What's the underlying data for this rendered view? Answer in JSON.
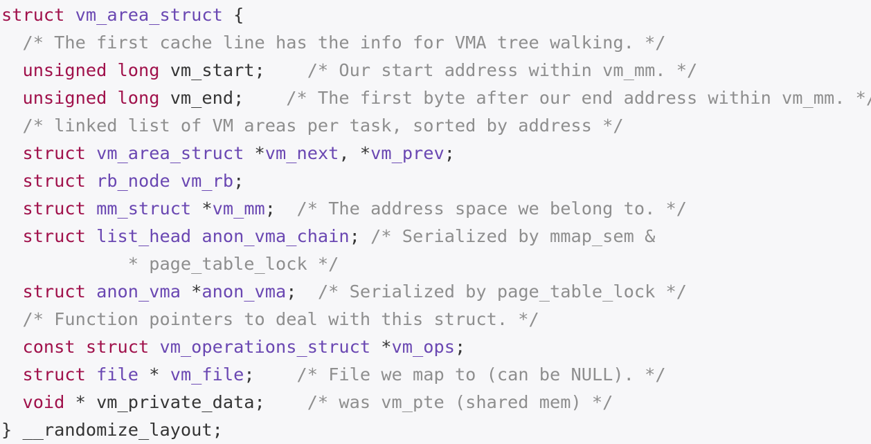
{
  "colors": {
    "background": "#f7f7f9",
    "keyword": "#a0114b",
    "type": "#6a47b2",
    "comment": "#8e8e8e",
    "plain": "#353535"
  },
  "code": {
    "lines": [
      [
        {
          "t": "keyword",
          "v": "struct"
        },
        {
          "t": "plain",
          "v": " "
        },
        {
          "t": "type",
          "v": "vm_area_struct"
        },
        {
          "t": "plain",
          "v": " {"
        }
      ],
      [
        {
          "t": "plain",
          "v": "  "
        },
        {
          "t": "comment",
          "v": "/* The first cache line has the info for VMA tree walking. */"
        }
      ],
      [
        {
          "t": "plain",
          "v": "  "
        },
        {
          "t": "keyword",
          "v": "unsigned long"
        },
        {
          "t": "plain",
          "v": " vm_start;    "
        },
        {
          "t": "comment",
          "v": "/* Our start address within vm_mm. */"
        }
      ],
      [
        {
          "t": "plain",
          "v": "  "
        },
        {
          "t": "keyword",
          "v": "unsigned long"
        },
        {
          "t": "plain",
          "v": " vm_end;    "
        },
        {
          "t": "comment",
          "v": "/* The first byte after our end address within vm_mm. */"
        }
      ],
      [
        {
          "t": "plain",
          "v": "  "
        },
        {
          "t": "comment",
          "v": "/* linked list of VM areas per task, sorted by address */"
        }
      ],
      [
        {
          "t": "plain",
          "v": "  "
        },
        {
          "t": "keyword",
          "v": "struct"
        },
        {
          "t": "plain",
          "v": " "
        },
        {
          "t": "type",
          "v": "vm_area_struct"
        },
        {
          "t": "plain",
          "v": " *"
        },
        {
          "t": "type",
          "v": "vm_next"
        },
        {
          "t": "plain",
          "v": ", *"
        },
        {
          "t": "type",
          "v": "vm_prev"
        },
        {
          "t": "plain",
          "v": ";"
        }
      ],
      [
        {
          "t": "plain",
          "v": "  "
        },
        {
          "t": "keyword",
          "v": "struct"
        },
        {
          "t": "plain",
          "v": " "
        },
        {
          "t": "type",
          "v": "rb_node vm_rb"
        },
        {
          "t": "plain",
          "v": ";"
        }
      ],
      [
        {
          "t": "plain",
          "v": "  "
        },
        {
          "t": "keyword",
          "v": "struct"
        },
        {
          "t": "plain",
          "v": " "
        },
        {
          "t": "type",
          "v": "mm_struct"
        },
        {
          "t": "plain",
          "v": " *"
        },
        {
          "t": "type",
          "v": "vm_mm"
        },
        {
          "t": "plain",
          "v": ";  "
        },
        {
          "t": "comment",
          "v": "/* The address space we belong to. */"
        }
      ],
      [
        {
          "t": "plain",
          "v": "  "
        },
        {
          "t": "keyword",
          "v": "struct"
        },
        {
          "t": "plain",
          "v": " "
        },
        {
          "t": "type",
          "v": "list_head anon_vma_chain"
        },
        {
          "t": "plain",
          "v": "; "
        },
        {
          "t": "comment",
          "v": "/* Serialized by mmap_sem &"
        }
      ],
      [
        {
          "t": "comment",
          "v": "            * page_table_lock */"
        }
      ],
      [
        {
          "t": "plain",
          "v": "  "
        },
        {
          "t": "keyword",
          "v": "struct"
        },
        {
          "t": "plain",
          "v": " "
        },
        {
          "t": "type",
          "v": "anon_vma"
        },
        {
          "t": "plain",
          "v": " *"
        },
        {
          "t": "type",
          "v": "anon_vma"
        },
        {
          "t": "plain",
          "v": ";  "
        },
        {
          "t": "comment",
          "v": "/* Serialized by page_table_lock */"
        }
      ],
      [
        {
          "t": "plain",
          "v": "  "
        },
        {
          "t": "comment",
          "v": "/* Function pointers to deal with this struct. */"
        }
      ],
      [
        {
          "t": "plain",
          "v": "  "
        },
        {
          "t": "keyword",
          "v": "const struct"
        },
        {
          "t": "plain",
          "v": " "
        },
        {
          "t": "type",
          "v": "vm_operations_struct"
        },
        {
          "t": "plain",
          "v": " *"
        },
        {
          "t": "type",
          "v": "vm_ops"
        },
        {
          "t": "plain",
          "v": ";"
        }
      ],
      [
        {
          "t": "plain",
          "v": "  "
        },
        {
          "t": "keyword",
          "v": "struct"
        },
        {
          "t": "plain",
          "v": " "
        },
        {
          "t": "type",
          "v": "file"
        },
        {
          "t": "plain",
          "v": " * "
        },
        {
          "t": "type",
          "v": "vm_file"
        },
        {
          "t": "plain",
          "v": ";    "
        },
        {
          "t": "comment",
          "v": "/* File we map to (can be NULL). */"
        }
      ],
      [
        {
          "t": "plain",
          "v": "  "
        },
        {
          "t": "keyword",
          "v": "void"
        },
        {
          "t": "plain",
          "v": " * vm_private_data;    "
        },
        {
          "t": "comment",
          "v": "/* was vm_pte (shared mem) */"
        }
      ],
      [
        {
          "t": "plain",
          "v": "} __randomize_layout;"
        }
      ]
    ]
  }
}
